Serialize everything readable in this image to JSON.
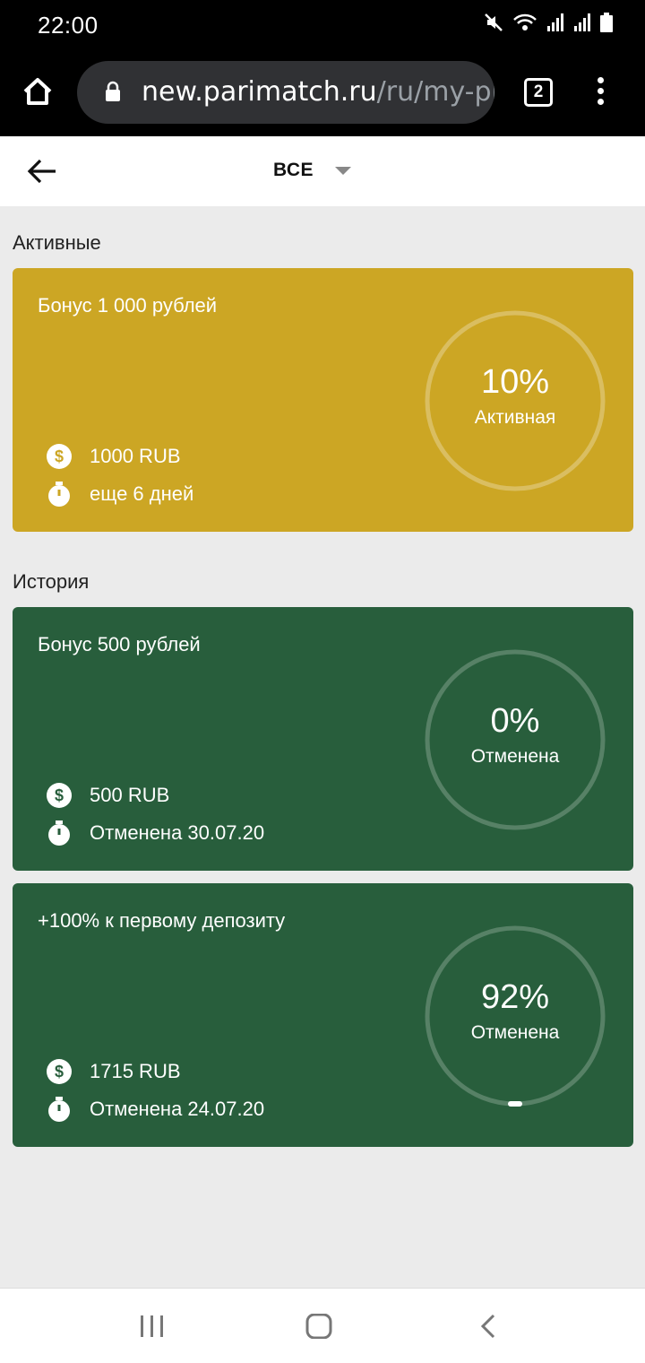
{
  "status": {
    "time": "22:00"
  },
  "browser": {
    "url_main": "new.parimatch.ru",
    "url_path": "/ru/my-pro",
    "tab_count": "2"
  },
  "header": {
    "filter_label": "ВСЕ"
  },
  "sections": {
    "active_title": "Активные",
    "history_title": "История"
  },
  "cards": [
    {
      "title": "Бонус 1 000 рублей",
      "amount": "1000 RUB",
      "time_text": "еще 6 дней",
      "percent": "10%",
      "status": "Активная",
      "progress": 0.1,
      "color": "#cca624"
    },
    {
      "title": "Бонус 500 рублей",
      "amount": "500 RUB",
      "time_text": "Отменена 30.07.20",
      "percent": "0%",
      "status": "Отменена",
      "progress": 0.0,
      "color": "#285e3c"
    },
    {
      "title": "+100% к первому депозиту",
      "amount": "1715 RUB",
      "time_text": "Отменена 24.07.20",
      "percent": "92%",
      "status": "Отменена",
      "progress": 0.92,
      "color": "#285e3c"
    }
  ],
  "icons": {
    "coin": "dollar-coin-icon",
    "timer": "stopwatch-icon"
  }
}
